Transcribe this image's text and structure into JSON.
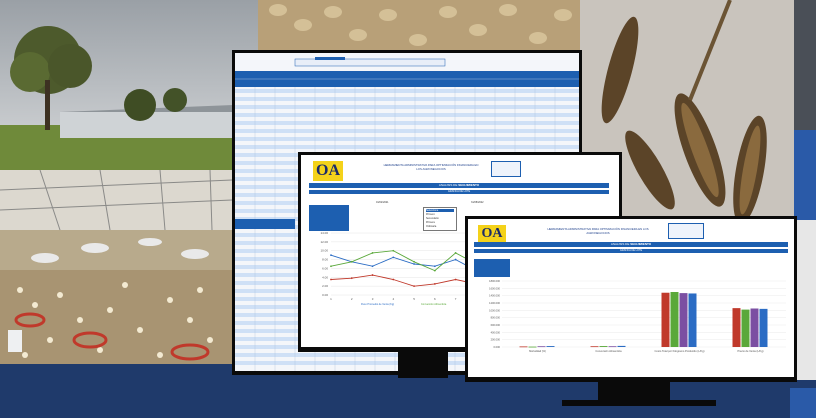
{
  "colors": {
    "brand_blue": "#1d5fb0",
    "logo_yellow": "#f4d21a",
    "bottom_band": "#1f3a6b",
    "series_blue": "#2b6cc4",
    "series_green": "#5aa83a",
    "series_red": "#c0392b",
    "series_purple": "#7b4fa2"
  },
  "screens": {
    "middle": {
      "logo": "OA",
      "header": "HERRAMIENTA ADMINISTRATIVA PARA OPTIMIZACIÓN FINANCIERA EN LOS AGRONEGOCIOS",
      "section_title": "ANALISIS DE ",
      "section_title_em": "SEGUIMIENTO",
      "subsection": "GRÁFICA DE LOTE",
      "date_from": "01/02/2021",
      "date_to": "31/08/2022",
      "dropdown_options": [
        "Seleccione",
        "Primero",
        "Secundario",
        "Primera",
        "Ordinaria"
      ],
      "legend": [
        "Peso Promedio de Venta (Kg)",
        "Conversión Alimenticia",
        "Mortalidad %"
      ]
    },
    "front": {
      "logo": "OA",
      "header": "HERRAMIENTA ADMINISTRATIVA PARA OPTIMIZACIÓN FINANCIERA EN LOS AGRONEGOCIOS",
      "section_title": "ANALISIS DE ",
      "section_title_em": "SEGUIMIENTO",
      "subsection": "GRÁFICA DE LOTE",
      "y_ticks": [
        "1800.000",
        "1600.000",
        "1400.000",
        "1200.000",
        "1000.000",
        "800.000",
        "600.000",
        "400.000",
        "200.000",
        "0.000"
      ],
      "categories": [
        "Mortalidad (%)",
        "Conversión Alimenticia",
        "Costo Total por Kilogramo Producido (L/Kg)",
        "Precio de Venta (L/Kg)"
      ]
    }
  },
  "chart_data": [
    {
      "type": "line",
      "title": "",
      "x": [
        1,
        2,
        3,
        4,
        5,
        6,
        7,
        8,
        9,
        10,
        11,
        12,
        13,
        14
      ],
      "series": [
        {
          "name": "Peso Promedio de Venta (Kg)",
          "values": [
            9.0,
            7.5,
            6.5,
            8.5,
            7.0,
            6.5,
            8.0,
            5.5,
            7.0,
            6.5,
            8.5,
            7.5,
            8.0,
            7.0
          ]
        },
        {
          "name": "Conversión Alimenticia",
          "values": [
            6.5,
            7.5,
            9.5,
            10.0,
            7.5,
            5.5,
            9.5,
            7.0,
            4.0,
            6.0,
            5.0,
            7.5,
            8.0,
            7.0
          ]
        },
        {
          "name": "Mortalidad %",
          "values": [
            3.5,
            3.8,
            4.5,
            3.5,
            2.0,
            2.5,
            3.5,
            2.5,
            3.0,
            1.5,
            2.5,
            3.0,
            1.5,
            3.5
          ]
        }
      ],
      "ylim": [
        0,
        14
      ],
      "xlabel": "",
      "ylabel": ""
    },
    {
      "type": "bar",
      "title": "",
      "categories": [
        "Mortalidad (%)",
        "Conversión Alimenticia",
        "Costo Total por Kilogramo Producido (L/Kg)",
        "Precio de Venta (L/Kg)"
      ],
      "series": [
        {
          "values": [
            15,
            20,
            1480,
            1060
          ]
        },
        {
          "values": [
            10,
            25,
            1500,
            1020
          ]
        },
        {
          "values": [
            20,
            20,
            1470,
            1050
          ]
        },
        {
          "values": [
            25,
            30,
            1460,
            1040
          ]
        }
      ],
      "ylim": [
        0,
        1800
      ],
      "xlabel": "",
      "ylabel": ""
    }
  ]
}
